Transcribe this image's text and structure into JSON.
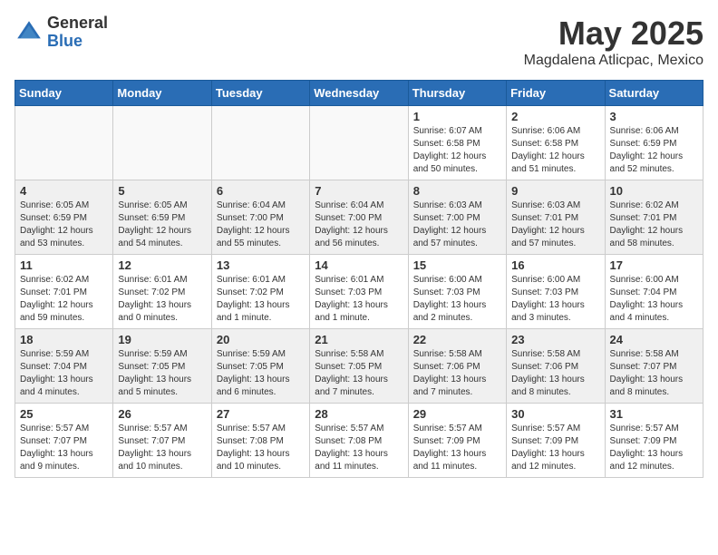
{
  "logo": {
    "general": "General",
    "blue": "Blue"
  },
  "title": "May 2025",
  "subtitle": "Magdalena Atlicpac, Mexico",
  "days_of_week": [
    "Sunday",
    "Monday",
    "Tuesday",
    "Wednesday",
    "Thursday",
    "Friday",
    "Saturday"
  ],
  "weeks": [
    [
      {
        "day": "",
        "info": ""
      },
      {
        "day": "",
        "info": ""
      },
      {
        "day": "",
        "info": ""
      },
      {
        "day": "",
        "info": ""
      },
      {
        "day": "1",
        "info": "Sunrise: 6:07 AM\nSunset: 6:58 PM\nDaylight: 12 hours\nand 50 minutes."
      },
      {
        "day": "2",
        "info": "Sunrise: 6:06 AM\nSunset: 6:58 PM\nDaylight: 12 hours\nand 51 minutes."
      },
      {
        "day": "3",
        "info": "Sunrise: 6:06 AM\nSunset: 6:59 PM\nDaylight: 12 hours\nand 52 minutes."
      }
    ],
    [
      {
        "day": "4",
        "info": "Sunrise: 6:05 AM\nSunset: 6:59 PM\nDaylight: 12 hours\nand 53 minutes."
      },
      {
        "day": "5",
        "info": "Sunrise: 6:05 AM\nSunset: 6:59 PM\nDaylight: 12 hours\nand 54 minutes."
      },
      {
        "day": "6",
        "info": "Sunrise: 6:04 AM\nSunset: 7:00 PM\nDaylight: 12 hours\nand 55 minutes."
      },
      {
        "day": "7",
        "info": "Sunrise: 6:04 AM\nSunset: 7:00 PM\nDaylight: 12 hours\nand 56 minutes."
      },
      {
        "day": "8",
        "info": "Sunrise: 6:03 AM\nSunset: 7:00 PM\nDaylight: 12 hours\nand 57 minutes."
      },
      {
        "day": "9",
        "info": "Sunrise: 6:03 AM\nSunset: 7:01 PM\nDaylight: 12 hours\nand 57 minutes."
      },
      {
        "day": "10",
        "info": "Sunrise: 6:02 AM\nSunset: 7:01 PM\nDaylight: 12 hours\nand 58 minutes."
      }
    ],
    [
      {
        "day": "11",
        "info": "Sunrise: 6:02 AM\nSunset: 7:01 PM\nDaylight: 12 hours\nand 59 minutes."
      },
      {
        "day": "12",
        "info": "Sunrise: 6:01 AM\nSunset: 7:02 PM\nDaylight: 13 hours\nand 0 minutes."
      },
      {
        "day": "13",
        "info": "Sunrise: 6:01 AM\nSunset: 7:02 PM\nDaylight: 13 hours\nand 1 minute."
      },
      {
        "day": "14",
        "info": "Sunrise: 6:01 AM\nSunset: 7:03 PM\nDaylight: 13 hours\nand 1 minute."
      },
      {
        "day": "15",
        "info": "Sunrise: 6:00 AM\nSunset: 7:03 PM\nDaylight: 13 hours\nand 2 minutes."
      },
      {
        "day": "16",
        "info": "Sunrise: 6:00 AM\nSunset: 7:03 PM\nDaylight: 13 hours\nand 3 minutes."
      },
      {
        "day": "17",
        "info": "Sunrise: 6:00 AM\nSunset: 7:04 PM\nDaylight: 13 hours\nand 4 minutes."
      }
    ],
    [
      {
        "day": "18",
        "info": "Sunrise: 5:59 AM\nSunset: 7:04 PM\nDaylight: 13 hours\nand 4 minutes."
      },
      {
        "day": "19",
        "info": "Sunrise: 5:59 AM\nSunset: 7:05 PM\nDaylight: 13 hours\nand 5 minutes."
      },
      {
        "day": "20",
        "info": "Sunrise: 5:59 AM\nSunset: 7:05 PM\nDaylight: 13 hours\nand 6 minutes."
      },
      {
        "day": "21",
        "info": "Sunrise: 5:58 AM\nSunset: 7:05 PM\nDaylight: 13 hours\nand 7 minutes."
      },
      {
        "day": "22",
        "info": "Sunrise: 5:58 AM\nSunset: 7:06 PM\nDaylight: 13 hours\nand 7 minutes."
      },
      {
        "day": "23",
        "info": "Sunrise: 5:58 AM\nSunset: 7:06 PM\nDaylight: 13 hours\nand 8 minutes."
      },
      {
        "day": "24",
        "info": "Sunrise: 5:58 AM\nSunset: 7:07 PM\nDaylight: 13 hours\nand 8 minutes."
      }
    ],
    [
      {
        "day": "25",
        "info": "Sunrise: 5:57 AM\nSunset: 7:07 PM\nDaylight: 13 hours\nand 9 minutes."
      },
      {
        "day": "26",
        "info": "Sunrise: 5:57 AM\nSunset: 7:07 PM\nDaylight: 13 hours\nand 10 minutes."
      },
      {
        "day": "27",
        "info": "Sunrise: 5:57 AM\nSunset: 7:08 PM\nDaylight: 13 hours\nand 10 minutes."
      },
      {
        "day": "28",
        "info": "Sunrise: 5:57 AM\nSunset: 7:08 PM\nDaylight: 13 hours\nand 11 minutes."
      },
      {
        "day": "29",
        "info": "Sunrise: 5:57 AM\nSunset: 7:09 PM\nDaylight: 13 hours\nand 11 minutes."
      },
      {
        "day": "30",
        "info": "Sunrise: 5:57 AM\nSunset: 7:09 PM\nDaylight: 13 hours\nand 12 minutes."
      },
      {
        "day": "31",
        "info": "Sunrise: 5:57 AM\nSunset: 7:09 PM\nDaylight: 13 hours\nand 12 minutes."
      }
    ]
  ]
}
